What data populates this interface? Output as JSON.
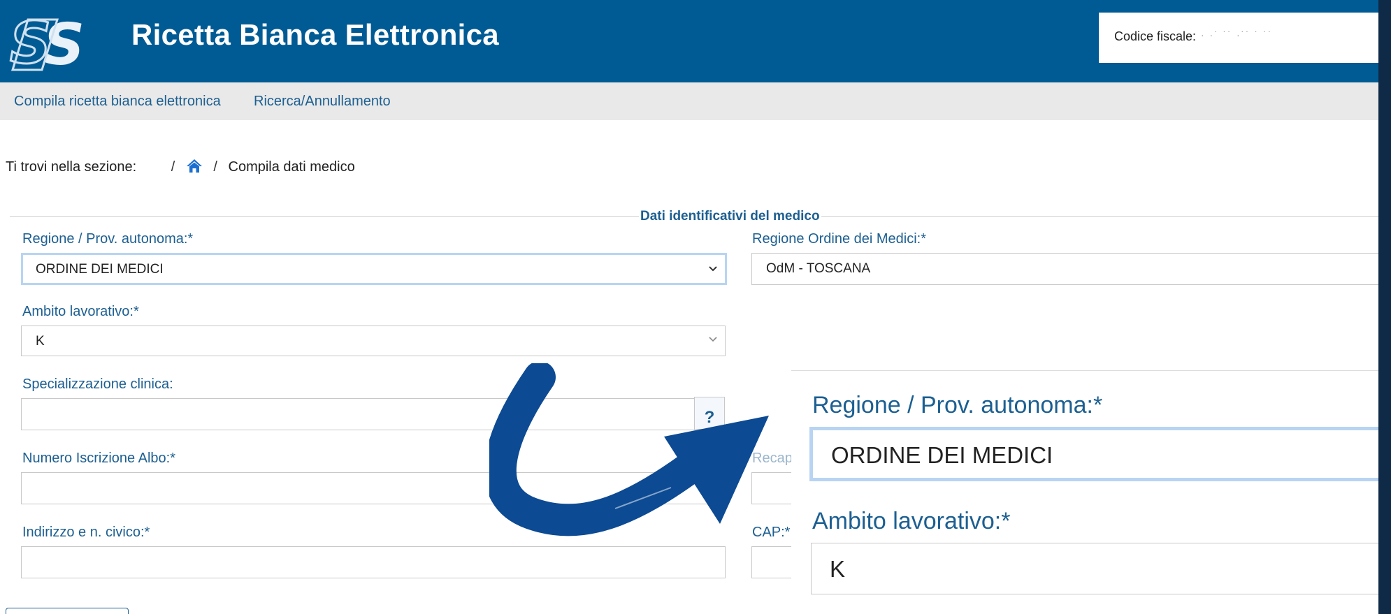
{
  "header": {
    "logo_text": "STS",
    "title": "Ricetta Bianca Elettronica",
    "codice_fiscale_label": "Codice fiscale:"
  },
  "nav": {
    "items": [
      {
        "label": "Compila ricetta bianca elettronica"
      },
      {
        "label": "Ricerca/Annullamento"
      }
    ]
  },
  "breadcrumb": {
    "prefix": "Ti trovi nella sezione:",
    "current": "Compila dati medico",
    "home_icon": "home-icon"
  },
  "form": {
    "legend": "Dati identificativi del medico",
    "regione": {
      "label": "Regione / Prov. autonoma:*",
      "value": "ORDINE DEI MEDICI"
    },
    "regione_ordine": {
      "label": "Regione Ordine dei Medici:*",
      "value": "OdM - TOSCANA"
    },
    "ambito": {
      "label": "Ambito lavorativo:*",
      "value": "K"
    },
    "specializzazione": {
      "label": "Specializzazione clinica:",
      "value": "",
      "help_label": "?"
    },
    "numero_albo": {
      "label": "Numero Iscrizione Albo:*",
      "value": ""
    },
    "recapito": {
      "label": "Recap",
      "value": ""
    },
    "indirizzo": {
      "label": "Indirizzo e n. civico:*",
      "value": ""
    },
    "cap": {
      "label": "CAP:*",
      "value": ""
    }
  },
  "zoom": {
    "regione_label": "Regione / Prov. autonoma:*",
    "regione_value": "ORDINE DEI MEDICI",
    "ambito_label": "Ambito lavorativo:*",
    "ambito_value": "K"
  },
  "colors": {
    "header_bg": "#005b94",
    "link": "#1c5f91",
    "arrow": "#0c4a93",
    "frame": "#0f2a47"
  }
}
